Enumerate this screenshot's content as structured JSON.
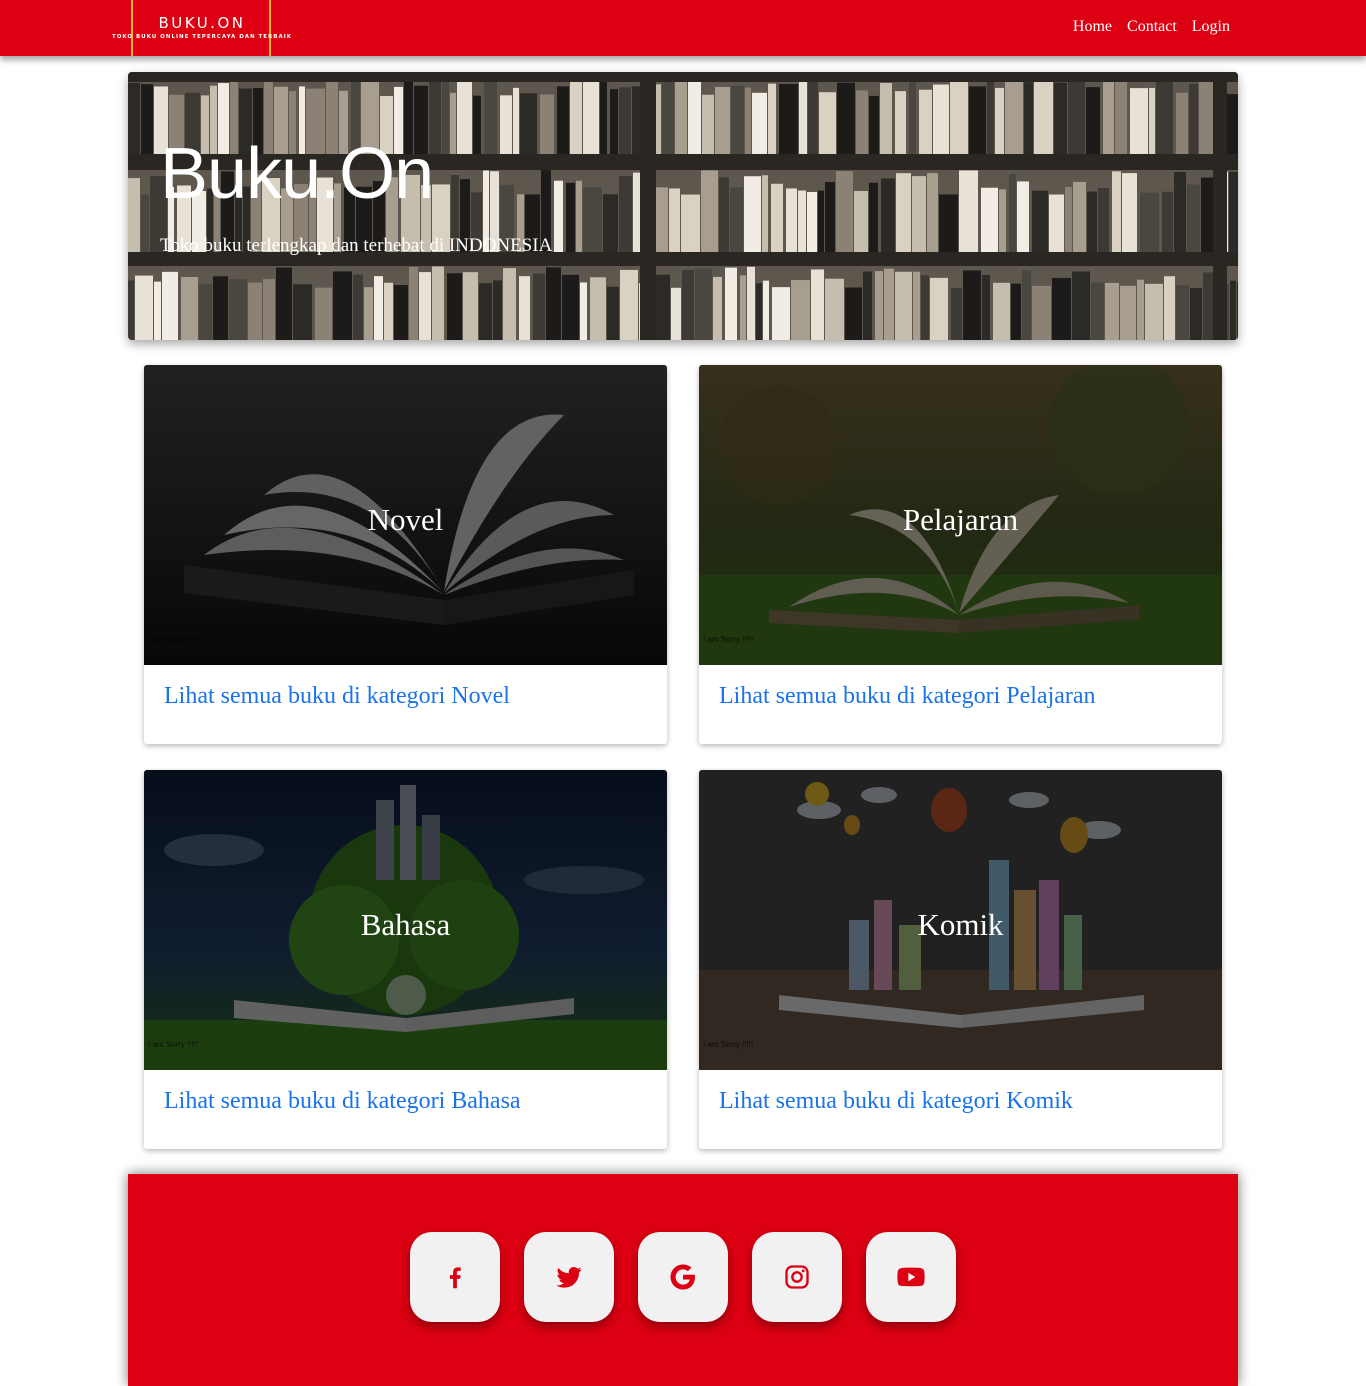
{
  "navbar": {
    "logo_title": "BUKU.ON",
    "logo_tagline": "TOKO BUKU ONLINE TEPERCAYA DAN TERBAIK",
    "links": [
      "Home",
      "Contact",
      "Login"
    ]
  },
  "hero": {
    "title": "Buku.On",
    "subtitle": "Toko buku terlengkap dan terhebat di INDONESIA"
  },
  "categories": [
    {
      "name": "Novel",
      "link": "Lihat semua buku di kategori Novel",
      "watermark": "I am Sorry !!!!!"
    },
    {
      "name": "Pelajaran",
      "link": "Lihat semua buku di kategori Pelajaran",
      "watermark": "I am Sorry !!!!!"
    },
    {
      "name": "Bahasa",
      "link": "Lihat semua buku di kategori Bahasa",
      "watermark": "I am Sorry !!!!!"
    },
    {
      "name": "Komik",
      "link": "Lihat semua buku di kategori Komik",
      "watermark": "I am Sorry !!!!!"
    }
  ],
  "footer": {
    "social_icons": [
      "facebook-icon",
      "twitter-icon",
      "google-icon",
      "instagram-icon",
      "youtube-icon"
    ]
  },
  "colors": {
    "brand_red": "#dc0012",
    "link_blue": "#1a73e8",
    "logo_accent": "#f0b428"
  }
}
